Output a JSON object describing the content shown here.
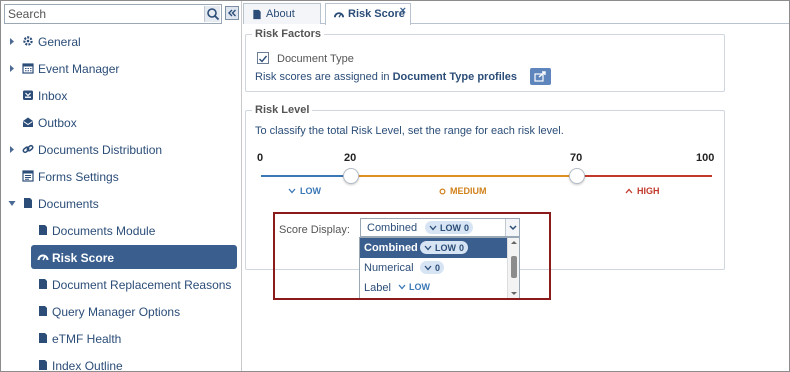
{
  "sidebar": {
    "search_placeholder": "Search",
    "items": [
      {
        "label": "General",
        "icon": "gear-icon",
        "expandable": true
      },
      {
        "label": "Event Manager",
        "icon": "calendar-icon",
        "expandable": true
      },
      {
        "label": "Inbox",
        "icon": "inbox-icon",
        "expandable": false
      },
      {
        "label": "Outbox",
        "icon": "outbox-icon",
        "expandable": false
      },
      {
        "label": "Documents Distribution",
        "icon": "share-icon",
        "expandable": true
      },
      {
        "label": "Forms Settings",
        "icon": "form-icon",
        "expandable": false
      },
      {
        "label": "Documents",
        "icon": "document-icon",
        "expanded": true
      }
    ],
    "children": [
      {
        "label": "Documents Module",
        "icon": "document-icon"
      },
      {
        "label": "Risk Score",
        "icon": "gauge-icon",
        "selected": true
      },
      {
        "label": "Document Replacement Reasons",
        "icon": "document-icon"
      },
      {
        "label": "Query Manager Options",
        "icon": "document-icon"
      },
      {
        "label": "eTMF Health",
        "icon": "document-icon"
      },
      {
        "label": "Index Outline",
        "icon": "document-icon"
      }
    ]
  },
  "tabs": [
    {
      "label": "About",
      "icon": "document-icon"
    },
    {
      "label": "Risk Score",
      "icon": "gauge-icon",
      "active": true,
      "close": "×"
    }
  ],
  "risk_factors": {
    "legend": "Risk Factors",
    "checkbox_label": "Document Type",
    "checked": true,
    "assign_prefix": "Risk scores are assigned in ",
    "assign_link": "Document Type profiles"
  },
  "risk_level": {
    "legend": "Risk Level",
    "description": "To classify the total Risk Level, set the range for each risk level.",
    "ticks": [
      "0",
      "20",
      "70",
      "100"
    ],
    "bands": {
      "low": "LOW",
      "medium": "MEDIUM",
      "high": "HIGH"
    },
    "thresholds": {
      "low_max": 20,
      "medium_max": 70,
      "max": 100
    }
  },
  "score_display": {
    "label": "Score Display:",
    "selected": "Combined",
    "selected_pill_level": "LOW",
    "selected_pill_value": "0",
    "options": [
      {
        "label": "Combined",
        "pill_level": "LOW",
        "pill_value": "0"
      },
      {
        "label": "Numerical",
        "pill_value": "0"
      },
      {
        "label": "Label",
        "pill_level": "LOW"
      }
    ]
  },
  "colors": {
    "accent": "#3a5f8f",
    "low": "#3a78b6",
    "medium": "#e08f23",
    "high": "#c0392b",
    "highlight": "#8b1a1a"
  }
}
